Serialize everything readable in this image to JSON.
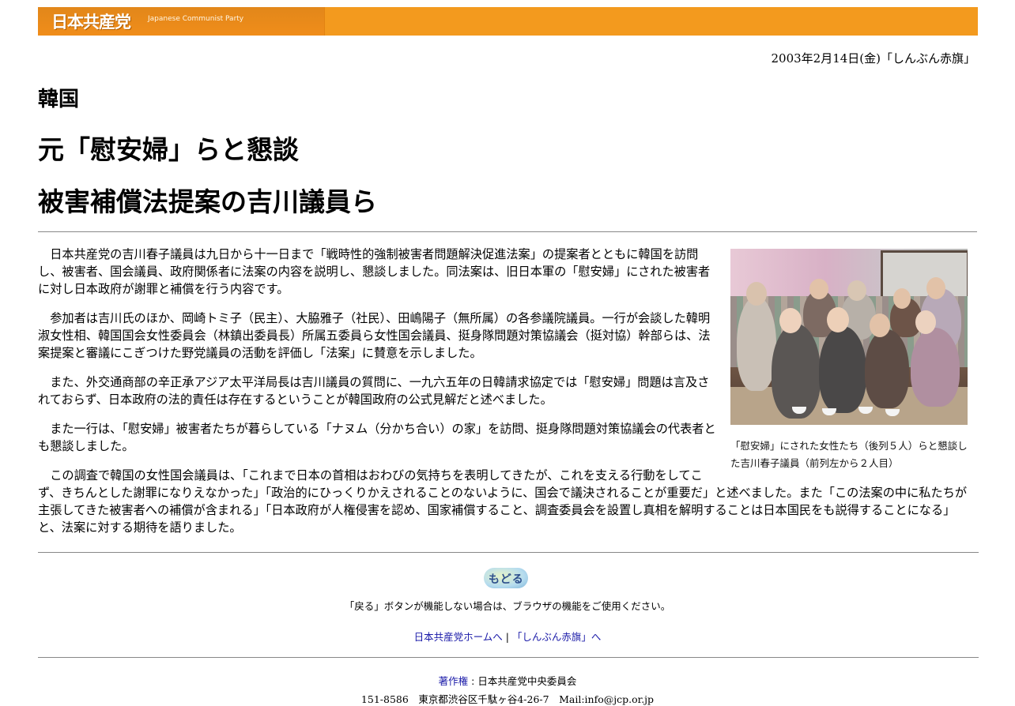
{
  "header": {
    "logo_text": "日本共産党",
    "logo_en": "Japanese Communist Party",
    "brand_color": "#f39a1e"
  },
  "dateline": "2003年2月14日(金)「しんぶん赤旗」",
  "headline": {
    "kicker": "韓国",
    "title_line1": "元「慰安婦」らと懇談",
    "title_line2": "被害補償法提案の吉川議員ら"
  },
  "article": {
    "paragraphs": [
      "日本共産党の吉川春子議員は九日から十一日まで「戦時性的強制被害者問題解決促進法案」の提案者とともに韓国を訪問し、被害者、国会議員、政府関係者に法案の内容を説明し、懇談しました。同法案は、旧日本軍の「慰安婦」にされた被害者に対し日本政府が謝罪と補償を行う内容です。",
      "参加者は吉川氏のほか、岡崎トミ子（民主）、大脇雅子（社民）、田嶋陽子（無所属）の各参議院議員。一行が会談した韓明淑女性相、韓国国会女性委員会（林鎮出委員長）所属五委員ら女性国会議員、挺身隊問題対策協議会（挺対協）幹部らは、法案提案と審議にこぎつけた野党議員の活動を評価し「法案」に賛意を示しました。",
      "また、外交通商部の辛正承アジア太平洋局長は吉川議員の質問に、一九六五年の日韓請求協定では「慰安婦」問題は言及されておらず、日本政府の法的責任は存在するということが韓国政府の公式見解だと述べました。",
      "また一行は、「慰安婦」被害者たちが暮らしている「ナヌム（分かち合い）の家」を訪問、挺身隊問題対策協議会の代表者とも懇談しました。",
      "この調査で韓国の女性国会議員は、「これまで日本の首相はおわびの気持ちを表明してきたが、これを支える行動をしてこず、きちんとした謝罪になりえなかった」「政治的にひっくりかえされることのないように、国会で議決されることが重要だ」と述べました。また「この法案の中に私たちが主張してきた被害者への補償が含まれる」「日本政府が人権侵害を認め、国家補償すること、調査委員会を設置し真相を解明することは日本国民をも説得することになる」と、法案に対する期待を語りました。"
    ],
    "photo_caption": "「慰安婦」にされた女性たち（後列５人）らと懇談した吉川春子議員（前列左から２人目）"
  },
  "nav": {
    "back_button_label": "もどる",
    "back_note": "「戻る」ボタンが機能しない場合は、ブラウザの機能をご使用ください。",
    "home_link": "日本共産党ホームへ",
    "separator": "|",
    "akahata_link": "「しんぶん赤旗」へ"
  },
  "footer": {
    "copyright_label": "著作権",
    "copyright_owner": " : 日本共産党中央委員会",
    "address": "151-8586　東京都渋谷区千駄ヶ谷4-26-7　Mail:info@jcp.or.jp"
  }
}
